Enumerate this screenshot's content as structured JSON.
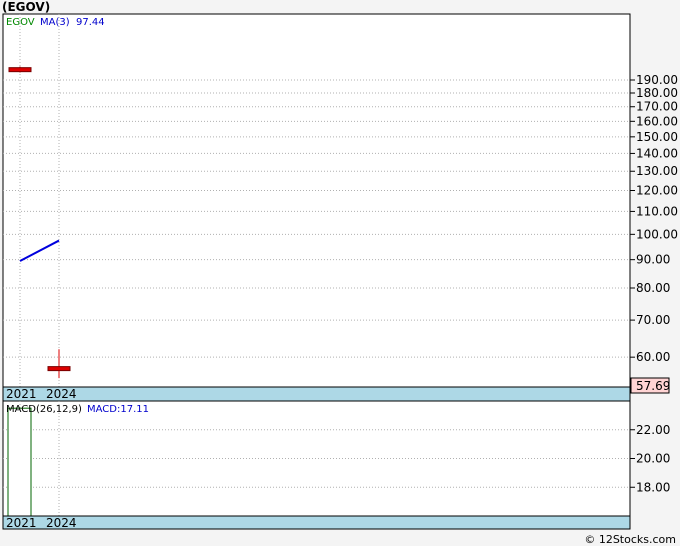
{
  "title": "(EGOV)",
  "footer": "© 12Stocks.com",
  "chart_data": [
    {
      "type": "candlestick",
      "ticker": "EGOV",
      "years": [
        "2021",
        "2024"
      ],
      "ma_label": "MA(3)",
      "ma_value": "97.44",
      "last_price_label": "57.69",
      "y_scale": "log",
      "ylim": [
        53,
        250
      ],
      "yticks": [
        "190.00",
        "180.00",
        "170.00",
        "160.00",
        "150.00",
        "140.00",
        "130.00",
        "120.00",
        "110.00",
        "100.00",
        "90.00",
        "80.00",
        "70.00",
        "60.00"
      ],
      "ytick_values": [
        190,
        180,
        170,
        160,
        150,
        140,
        130,
        120,
        110,
        100,
        90,
        80,
        70,
        60
      ],
      "candles": [
        {
          "period": "2021",
          "open": 200,
          "close": 197,
          "high": 201,
          "low": 196
        },
        {
          "period": "2024",
          "open": 57.69,
          "close": 56.9,
          "high": 62,
          "low": 55
        }
      ],
      "ma": [
        {
          "period": "2021",
          "value": 89.5
        },
        {
          "period": "2024",
          "value": 97.44
        }
      ],
      "colors": {
        "candle": "#dd0000",
        "ma": "#0000dd",
        "grid": "#b0b0b0"
      }
    },
    {
      "type": "bar",
      "label": "MACD(26,12,9)",
      "macd_label": "MACD:17.11",
      "years": [
        "2021",
        "2024"
      ],
      "yticks": [
        "22.00",
        "20.00",
        "18.00"
      ],
      "ytick_values": [
        22,
        20,
        18
      ],
      "ylim": [
        16,
        24
      ],
      "bars": [
        {
          "period": "2021",
          "value": 23.5
        }
      ],
      "colors": {
        "bar": "#006600"
      }
    }
  ]
}
